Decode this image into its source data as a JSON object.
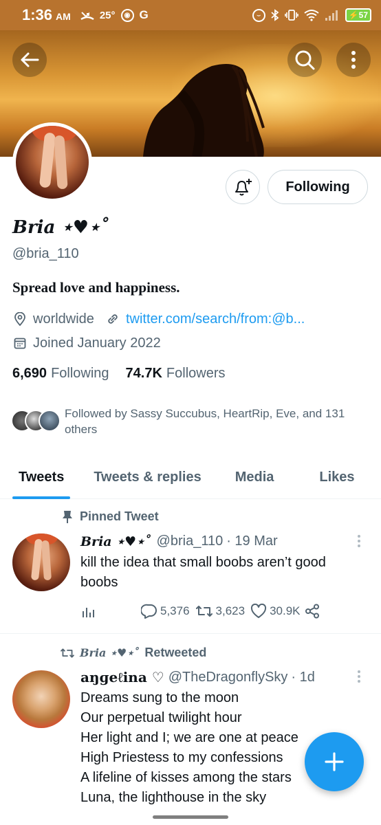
{
  "status_bar": {
    "time": "1:36",
    "ampm": "AM",
    "temperature": "25°",
    "right_icon_g": "G",
    "battery": "57"
  },
  "header": {
    "back_icon": "arrow-left-icon",
    "search_icon": "search-icon",
    "more_icon": "more-vertical-icon"
  },
  "profile": {
    "display_name": "Bria ⋆♥⋆˚",
    "handle": "@bria_110",
    "bio": "Spread love and happiness.",
    "location": "worldwide",
    "website": "twitter.com/search/from:@b...",
    "joined": "Joined January 2022",
    "following_count": "6,690",
    "following_label": "Following",
    "followers_count": "74.7K",
    "followers_label": "Followers",
    "followed_by": "Followed by Sassy Succubus, HeartRip, Eve, and 131 others",
    "follow_button": "Following",
    "accent_color": "#1d9bf0"
  },
  "tabs": [
    {
      "label": "Tweets",
      "active": true
    },
    {
      "label": "Tweets & replies",
      "active": false
    },
    {
      "label": "Media",
      "active": false
    },
    {
      "label": "Likes",
      "active": false
    }
  ],
  "tweets": [
    {
      "context": "Pinned Tweet",
      "name": "Bria ⋆♥⋆˚",
      "handle": "@bria_110",
      "date": "· 19 Mar",
      "text": "kill the idea that small boobs aren’t good boobs",
      "replies": "5,376",
      "retweets": "3,623",
      "likes": "30.9K"
    },
    {
      "context_name": "Bria ⋆♥⋆˚",
      "context_suffix": "Retweeted",
      "name": "aŋɡeℓina ♡",
      "handle": "@TheDragonflySky",
      "date": "· 1d",
      "lines": [
        "Dreams sung to the moon",
        "Our perpetual twilight hour",
        "Her light and I; we are one at peace",
        "High Priestess to my confessions",
        "A lifeline of kisses among the stars",
        "Luna, the lighthouse in the sky"
      ]
    }
  ],
  "fab": {
    "icon": "plus-icon"
  }
}
